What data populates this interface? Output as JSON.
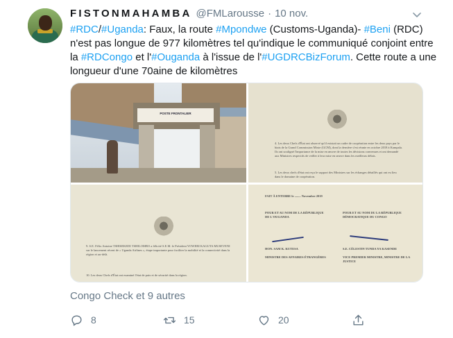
{
  "tweet": {
    "author_name": "FISTONMAHAMBA",
    "handle": "@FMLarousse",
    "separator": "·",
    "date": "10 nov.",
    "text_segments": [
      {
        "text": "#RDC",
        "link": true
      },
      {
        "text": "/",
        "link": false
      },
      {
        "text": "#Uganda",
        "link": true
      },
      {
        "text": ": Faux, la route ",
        "link": false
      },
      {
        "text": "#Mpondwe",
        "link": true
      },
      {
        "text": " (Customs-Uganda)- ",
        "link": false
      },
      {
        "text": "#Beni",
        "link": true
      },
      {
        "text": " (RDC) n'est pas longue de 977 kilomètres tel qu'indique le communiqué conjoint entre la ",
        "link": false
      },
      {
        "text": "#RDCongo",
        "link": true
      },
      {
        "text": " et l'",
        "link": false
      },
      {
        "text": "#Ouganda",
        "link": true
      },
      {
        "text": " à l'issue de l'",
        "link": false
      },
      {
        "text": "#UGDRCBizForum",
        "link": true
      },
      {
        "text": ". Cette route a une longueur d'une 70aine de kilomètres",
        "link": false
      }
    ],
    "media": {
      "photo_sign": "POSTE FRONTALIER",
      "doc_top": {
        "para4": "4. Les deux Chefs d'État ont observé qu'il existait un cadre de coopération entre les deux pays par le biais de la Grand Commission Mixte (GCM), dont la dernière s'est réunie en octobre 2018 à Kampala. Ils ont souligné l'importance de la mise en œuvre de toutes les décisions convenues et ont demandé aux Ministres respectifs de veiller à leur mise en œuvre dans les meilleurs délais.",
        "para5": "5. Les deux chefs d'état ont reçu le support des Ministres sur les échanges détaillés qui ont eu lieu dans le domaine de coopération."
      },
      "doc_left": {
        "para9": "9. S.E. Félix Antoine TSHISEKEDI TSHILOMBO a félicité S.E.M. le Président YOWERI KAGUTA MUSEVENI sur le lancement récent de « Uganda Airlines », étape importante pour faciliter la mobilité et la connectivité dans la région et au-delà.",
        "para10": "10. Les deux Chefs d'État ont examiné l'état de paix et de sécurité dans la région."
      },
      "doc_signatures": {
        "made_at": "FAIT À ENTEBBE le ........ Novembre 2019",
        "left_heading": "POUR ET AU NOM DE LA RÉPUBLIQUE DE L'OUGANDA",
        "right_heading": "POUR ET AU NOM DU LA RÉPUBLIQUE DÉMOCRATIQUE DU CONGO",
        "left_name": "HON. SAM K. KUTESA",
        "left_title": "MINISTRE DES AFFAIRES ÉTRANGÈRES",
        "right_name": "S.E. CÉLESTIN TUNDA YA KASENDE",
        "right_title": "VICE PREMIER MINISTRE, MINISTRE DE LA JUSTICE"
      }
    },
    "retweeted_by": "Congo Check et 9 autres",
    "actions": {
      "replies": "8",
      "retweets": "15",
      "likes": "20"
    },
    "icons": {
      "menu": "chevron-down-icon",
      "reply": "reply-icon",
      "retweet": "retweet-icon",
      "like": "heart-icon",
      "share": "share-icon"
    },
    "colors": {
      "link": "#1da1f2",
      "text": "#14171a",
      "muted": "#657786"
    }
  }
}
